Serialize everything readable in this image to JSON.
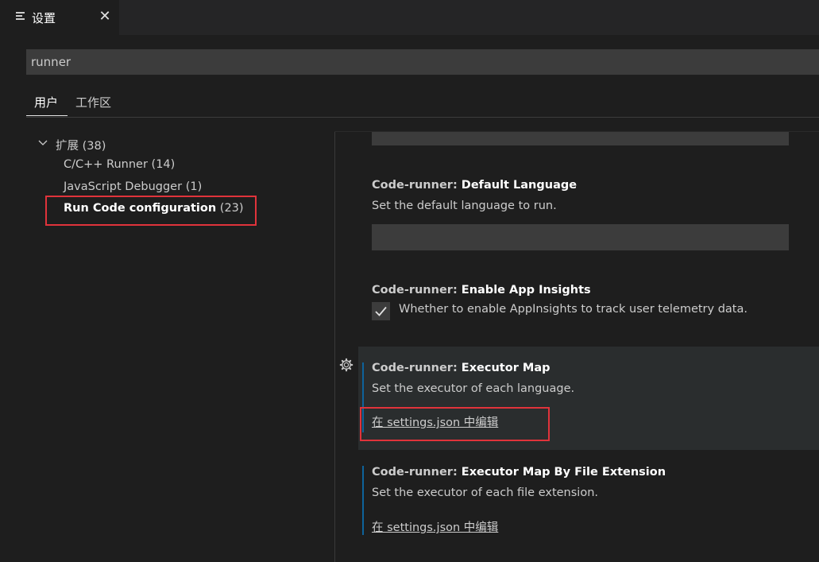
{
  "tab": {
    "title": "设置",
    "close": "✕"
  },
  "search": {
    "value": "runner"
  },
  "scopes": {
    "user": "用户",
    "workspace": "工作区"
  },
  "tree": {
    "root": {
      "label": "扩展",
      "count": "(38)"
    },
    "items": [
      {
        "label": "C/C++ Runner",
        "count": "(14)"
      },
      {
        "label": "JavaScript Debugger",
        "count": "(1)"
      },
      {
        "label": "Run Code configuration",
        "count": "(23)"
      }
    ]
  },
  "settings": [
    {
      "category": "Code-runner: ",
      "name": "Default Language",
      "description": "Set the default language to run."
    },
    {
      "category": "Code-runner: ",
      "name": "Enable App Insights",
      "description": "Whether to enable AppInsights to track user telemetry data."
    },
    {
      "category": "Code-runner: ",
      "name": "Executor Map",
      "description": "Set the executor of each language.",
      "link": "在 settings.json 中编辑"
    },
    {
      "category": "Code-runner: ",
      "name": "Executor Map By File Extension",
      "description": "Set the executor of each file extension.",
      "link": "在 settings.json 中编辑"
    }
  ],
  "colors": {
    "highlight": "#e0333b",
    "modified": "#0e639c"
  }
}
